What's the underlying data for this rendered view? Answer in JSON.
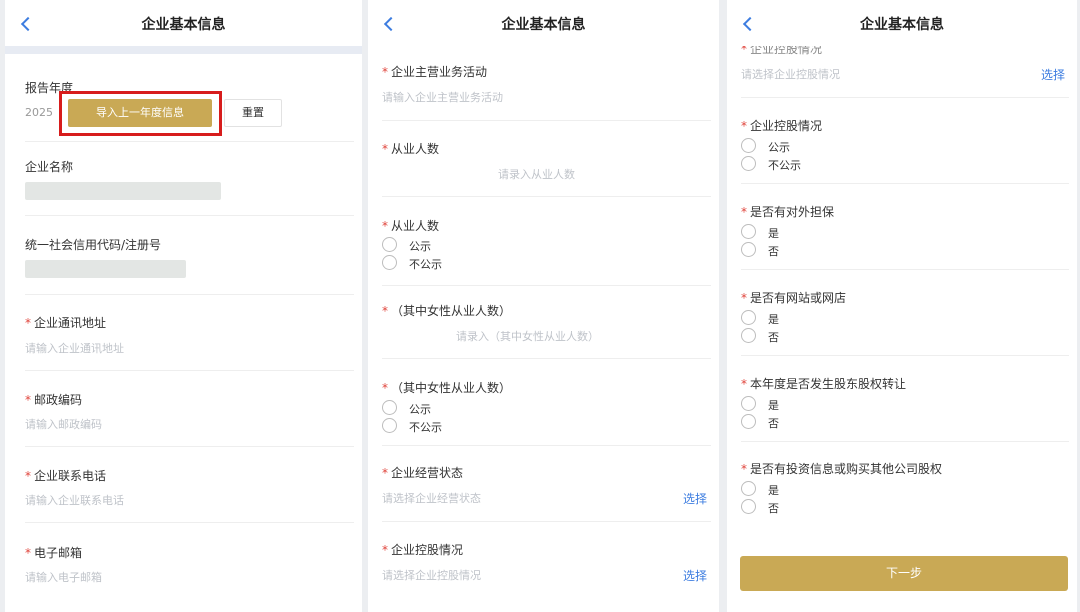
{
  "header_title": "企业基本信息",
  "panel1": {
    "report_year_label": "报告年度",
    "report_year_value": "2025",
    "import_button": "导入上一年度信息",
    "reset_button": "重置",
    "company_name_label": "企业名称",
    "credit_code_label": "统一社会信用代码/注册号",
    "address_label": "企业通讯地址",
    "address_placeholder": "请输入企业通讯地址",
    "postcode_label": "邮政编码",
    "postcode_placeholder": "请输入邮政编码",
    "phone_label": "企业联系电话",
    "phone_placeholder": "请输入企业联系电话",
    "email_label": "电子邮箱",
    "email_placeholder": "请输入电子邮箱"
  },
  "panel2": {
    "main_business_label": "企业主营业务活动",
    "main_business_placeholder": "请输入企业主营业务活动",
    "employees_label": "从业人数",
    "employees_placeholder": "请录入从业人数",
    "employees_public_label": "从业人数",
    "female_label": "（其中女性从业人数）",
    "female_placeholder": "请录入（其中女性从业人数）",
    "female_public_label": "（其中女性从业人数）",
    "op_status_label": "企业经营状态",
    "op_status_placeholder": "请选择企业经营状态",
    "holding_label": "企业控股情况",
    "holding_placeholder": "请选择企业控股情况",
    "select_link": "选择",
    "opt_public": "公示",
    "opt_not_public": "不公示"
  },
  "panel3": {
    "holding_top_label": "企业控股情况",
    "holding_top_placeholder": "请选择企业控股情况",
    "select_link": "选择",
    "holding_public_label": "企业控股情况",
    "guarantee_label": "是否有对外担保",
    "website_label": "是否有网站或网店",
    "equity_transfer_label": "本年度是否发生股东股权转让",
    "investment_label": "是否有投资信息或购买其他公司股权",
    "opt_public": "公示",
    "opt_not_public": "不公示",
    "opt_yes": "是",
    "opt_no": "否",
    "next_button": "下一步"
  },
  "colors": {
    "accent_gold": "#c9a955",
    "link_blue": "#3d7de0",
    "required_red": "#e0443b",
    "highlight_red": "#d71c1c"
  }
}
